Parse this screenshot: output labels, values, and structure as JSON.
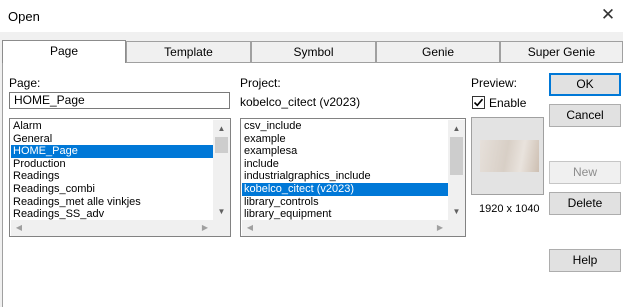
{
  "window": {
    "title": "Open"
  },
  "tabs": [
    {
      "label": "Page"
    },
    {
      "label": "Template"
    },
    {
      "label": "Symbol"
    },
    {
      "label": "Genie"
    },
    {
      "label": "Super Genie"
    }
  ],
  "page": {
    "label": "Page:",
    "value": "HOME_Page",
    "items": [
      "Alarm",
      "General",
      "HOME_Page",
      "Production",
      "Readings",
      "Readings_combi",
      "Readings_met alle vinkjes",
      "Readings_SS_adv"
    ],
    "selected": "HOME_Page"
  },
  "project": {
    "label": "Project:",
    "value": "kobelco_citect (v2023)",
    "items": [
      "csv_include",
      "example",
      "examplesa",
      "include",
      "industrialgraphics_include",
      "kobelco_citect (v2023)",
      "library_controls",
      "library_equipment"
    ],
    "selected": "kobelco_citect (v2023)"
  },
  "preview": {
    "label": "Preview:",
    "enable_label": "Enable",
    "enabled": true,
    "resolution": "1920 x 1040"
  },
  "buttons": {
    "ok": "OK",
    "cancel": "Cancel",
    "new": "New",
    "delete": "Delete",
    "help": "Help"
  },
  "colors": {
    "selection": "#0078d7",
    "default_button_border": "#0078d7"
  }
}
